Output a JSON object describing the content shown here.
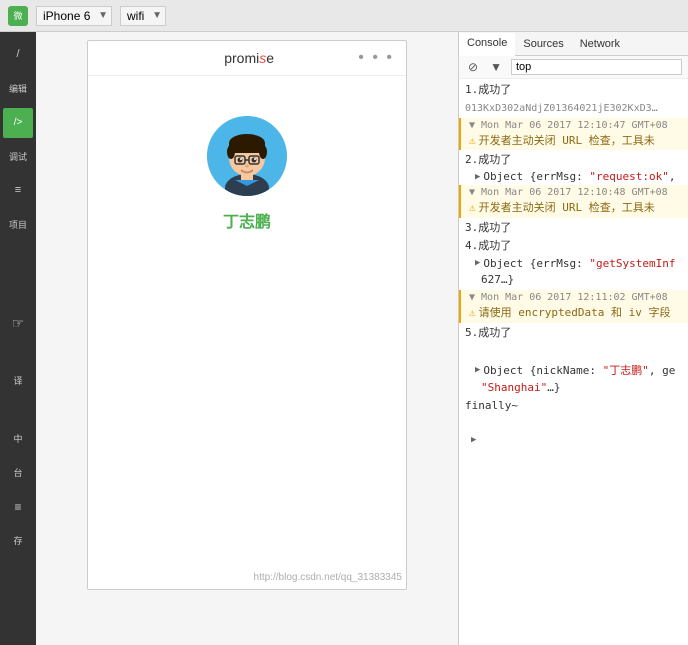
{
  "topbar": {
    "device": "iPhone 6",
    "network": "wifi"
  },
  "sidebar": {
    "items": [
      {
        "label": "/",
        "id": "slash",
        "active": false
      },
      {
        "label": "编辑",
        "id": "edit",
        "active": false
      },
      {
        "label": "/>",
        "id": "code",
        "active": true
      },
      {
        "label": "调试",
        "id": "debug",
        "active": false
      },
      {
        "label": "≡",
        "id": "menu",
        "active": false
      },
      {
        "label": "项目",
        "id": "project",
        "active": false
      },
      {
        "label": "↕",
        "id": "resize",
        "active": false
      },
      {
        "label": "↔",
        "id": "translate",
        "active": false
      },
      {
        "label": "台",
        "id": "platform",
        "active": false
      },
      {
        "label": "≡",
        "id": "layers",
        "active": false
      },
      {
        "label": "存",
        "id": "save",
        "active": false
      }
    ]
  },
  "phone": {
    "title_prefix": "promi",
    "title_highlight": "s",
    "title_suffix": "e",
    "dots": "• • •",
    "user_name": "丁志鹏"
  },
  "devtools": {
    "tabs": [
      {
        "label": "Console",
        "active": true
      },
      {
        "label": "Sources",
        "active": false
      },
      {
        "label": "Network",
        "active": false
      }
    ],
    "filter_placeholder": "top",
    "logs": [
      {
        "type": "success",
        "text": "1.成功了"
      },
      {
        "type": "code",
        "text": "013KxD302aNdjZ01364021jE302KxD3…"
      },
      {
        "type": "warning_header",
        "text": "Mon Mar 06 2017 12:10:47 GMT+08"
      },
      {
        "type": "warning_body",
        "text": "⚠ 开发者主动关闭 URL 检查，工具未"
      },
      {
        "type": "success",
        "text": "2.成功了"
      },
      {
        "type": "object",
        "text": "▶ Object {errMsg: \"request:ok\","
      },
      {
        "type": "warning_header",
        "text": "Mon Mar 06 2017 12:10:48 GMT+08"
      },
      {
        "type": "warning_body",
        "text": "⚠ 开发者主动关闭 URL 检查，工具未"
      },
      {
        "type": "success",
        "text": "3.成功了"
      },
      {
        "type": "success",
        "text": "4.成功了"
      },
      {
        "type": "object",
        "text": "▶ Object {errMsg: \"getSystemInf"
      },
      {
        "type": "object_continuation",
        "text": "627…}"
      },
      {
        "type": "warning_header",
        "text": "Mon Mar 06 2017 12:11:02 GMT+08"
      },
      {
        "type": "warning_body",
        "text": "⚠ 请使用 encryptedData 和 iv 字段"
      },
      {
        "type": "success",
        "text": "5.成功了"
      },
      {
        "type": "blank",
        "text": ""
      },
      {
        "type": "object",
        "text": "▶ Object {nickName: \"丁志鹏\", ge"
      },
      {
        "type": "object_continuation",
        "text": "\"Shanghai\"…}"
      },
      {
        "type": "finally",
        "text": "finally~"
      },
      {
        "type": "blank",
        "text": ""
      },
      {
        "type": "expand",
        "text": "▶"
      }
    ]
  },
  "watermark": {
    "text": "http://blog.csdn.net/qq_31383345"
  }
}
